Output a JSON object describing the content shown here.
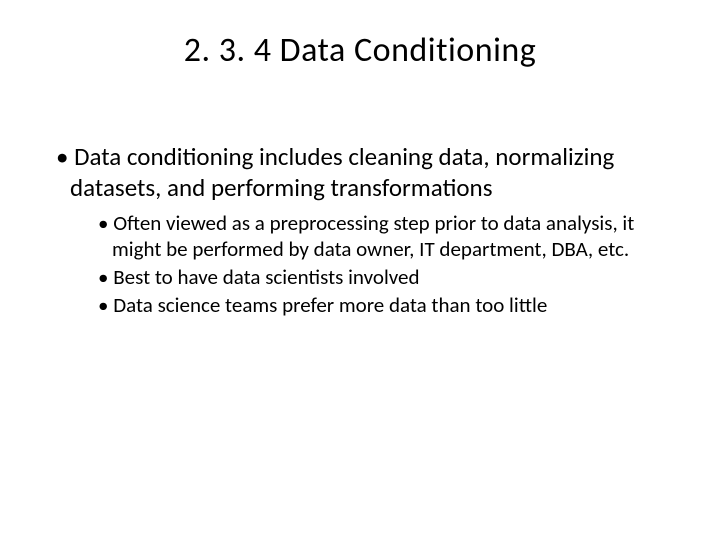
{
  "title": "2. 3. 4 Data Conditioning",
  "main_bullet": "Data conditioning includes cleaning data, normalizing datasets, and performing transformations",
  "sub_bullets": [
    "Often viewed as a preprocessing step prior to data analysis, it might be performed by data owner, IT department, DBA, etc.",
    "Best to have data scientists involved",
    "Data science teams prefer more data than too little"
  ]
}
